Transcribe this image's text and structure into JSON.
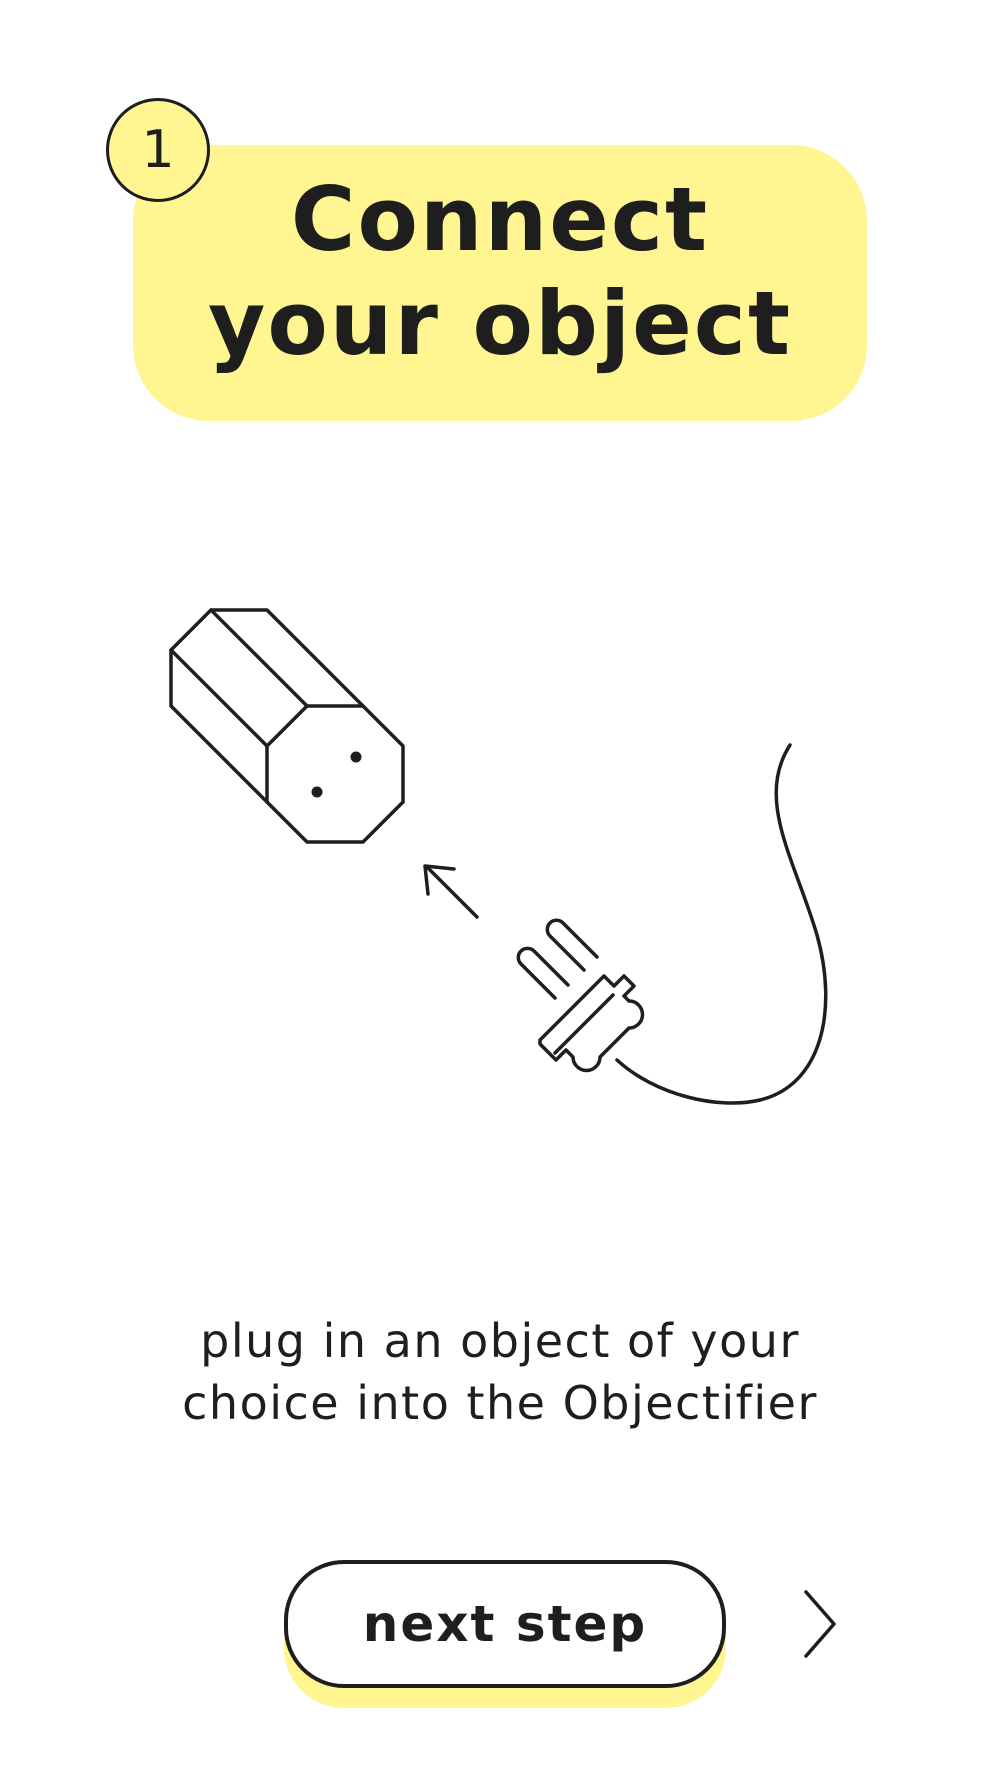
{
  "header": {
    "step_number": "1",
    "title_line1": "Connect",
    "title_line2": "your object"
  },
  "illustration": {
    "socket_icon": "octagonal-socket-icon",
    "arrow_icon": "arrow-up-left-icon",
    "plug_icon": "plug-with-cable-icon"
  },
  "description": {
    "line1": "plug in an object of your",
    "line2": "choice into the Objectifier"
  },
  "footer": {
    "next_label": "next step",
    "next_icon": "chevron-right-icon"
  },
  "colors": {
    "accent": "#fff591",
    "ink": "#1e1e1e",
    "background": "#ffffff"
  }
}
